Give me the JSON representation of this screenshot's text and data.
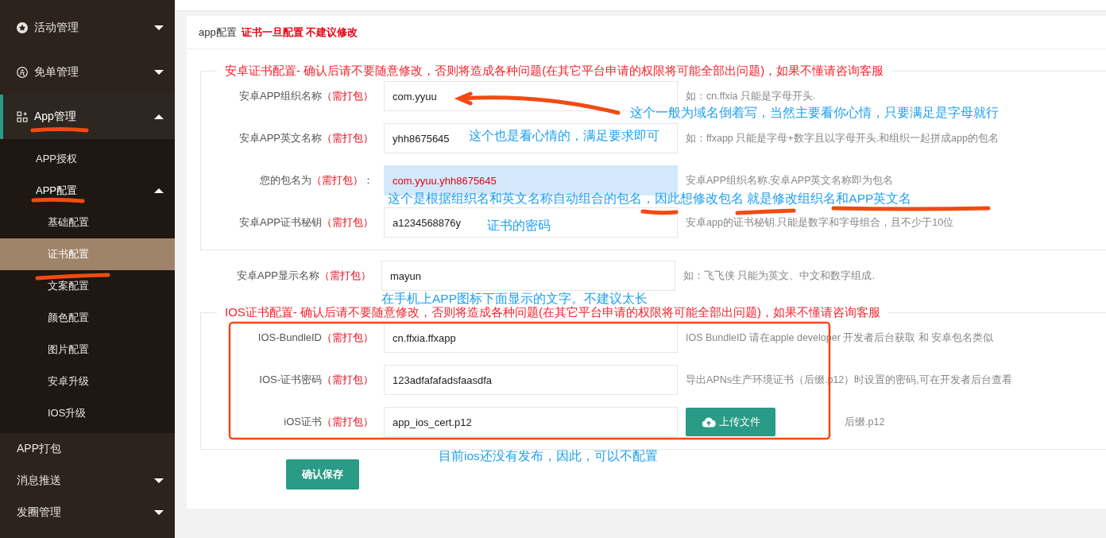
{
  "sidebar": {
    "items": [
      {
        "label": "活动管理",
        "expanded": false,
        "selected": false
      },
      {
        "label": "免单管理",
        "expanded": false,
        "selected": false
      },
      {
        "label": "App管理",
        "expanded": true,
        "selected": true,
        "children": [
          {
            "label": "APP授权",
            "selected": false
          },
          {
            "label": "APP配置",
            "expanded": true,
            "selected": false,
            "children": [
              {
                "label": "基础配置",
                "selected": false
              },
              {
                "label": "证书配置",
                "selected": true
              },
              {
                "label": "文案配置",
                "selected": false
              },
              {
                "label": "颜色配置",
                "selected": false
              },
              {
                "label": "图片配置",
                "selected": false
              },
              {
                "label": "安卓升级",
                "selected": false
              },
              {
                "label": "IOS升级",
                "selected": false
              }
            ]
          }
        ]
      },
      {
        "label": "APP打包",
        "selected": false
      },
      {
        "label": "消息推送",
        "expanded": false,
        "selected": false
      },
      {
        "label": "发圈管理",
        "expanded": false,
        "selected": false
      }
    ]
  },
  "card": {
    "title": "app配置",
    "warning": "证书一旦配置 不建议修改",
    "android": {
      "legend": "安卓证书配置- 确认后请不要随意修改，否则将造成各种问题(在其它平台申请的权限将可能全部出问题)，如果不懂请咨询客服",
      "fields": [
        {
          "kind": "text",
          "label": "安卓APP组织名称",
          "tag": "（需打包）",
          "value": "com.yyuu",
          "hint": "如：cn.ffxia 只能是字母开头."
        },
        {
          "kind": "text",
          "label": "安卓APP英文名称",
          "tag": "（需打包）",
          "value": "yhh8675645",
          "hint": "如：ffxapp 只能是字母+数字且以字母开头.和组织一起拼成app的包名"
        },
        {
          "kind": "readonly",
          "label": "您的包名为",
          "tag": "（需打包）",
          "suffix": "：",
          "value": "com.yyuu.yhh8675645",
          "hint": "安卓APP组织名称.安卓APP英文名称即为包名"
        },
        {
          "kind": "text",
          "label": "安卓APP证书秘钥",
          "tag": "（需打包）",
          "value": "a1234568876y",
          "hint": "安卓app的证书秘钥.只能是数字和字母组合，且不少于10位"
        }
      ]
    },
    "display_field": {
      "kind": "text",
      "label": "安卓APP显示名称",
      "tag": "（需打包）",
      "value": "mayun",
      "hint": "如：飞飞侠 只能为英文、中文和数字组成."
    },
    "ios": {
      "legend": "IOS证书配置- 确认后请不要随意修改，否则将造成各种问题(在其它平台申请的权限将可能全部出问题)，如果不懂请咨询客服",
      "fields": [
        {
          "kind": "text",
          "label": "IOS-BundleID",
          "tag": "（需打包）",
          "value": "cn.ffxia.ffxapp",
          "hint": "IOS BundleID 请在apple developer 开发者后台获取 和 安卓包名类似"
        },
        {
          "kind": "text",
          "label": "IOS-证书密码",
          "tag": "（需打包）",
          "value": "123adfafafadsfaasdfa",
          "hint": "导出APNs生产环境证书（后缀.p12）时设置的密码,可在开发者后台查看"
        },
        {
          "kind": "file",
          "label": "iOS证书",
          "tag": "（需打包）",
          "value": "app_ios_cert.p12",
          "button": "上传文件",
          "hint": "后缀.p12"
        }
      ]
    },
    "save_button": "确认保存"
  },
  "annotations": [
    "这个一般为域名倒着写，当然主要看你心情，只要满足是字母就行",
    "这个也是看心情的，满足要求即可",
    "这个是根据组织名和英文名称自动组合的包名，因此想修改包名 就是修改组织名和APP英文名",
    "证书的密码",
    "在手机上APP图标下面显示的文字。不建议太长",
    "目前ios还没有发布，因此，可以不配置"
  ]
}
